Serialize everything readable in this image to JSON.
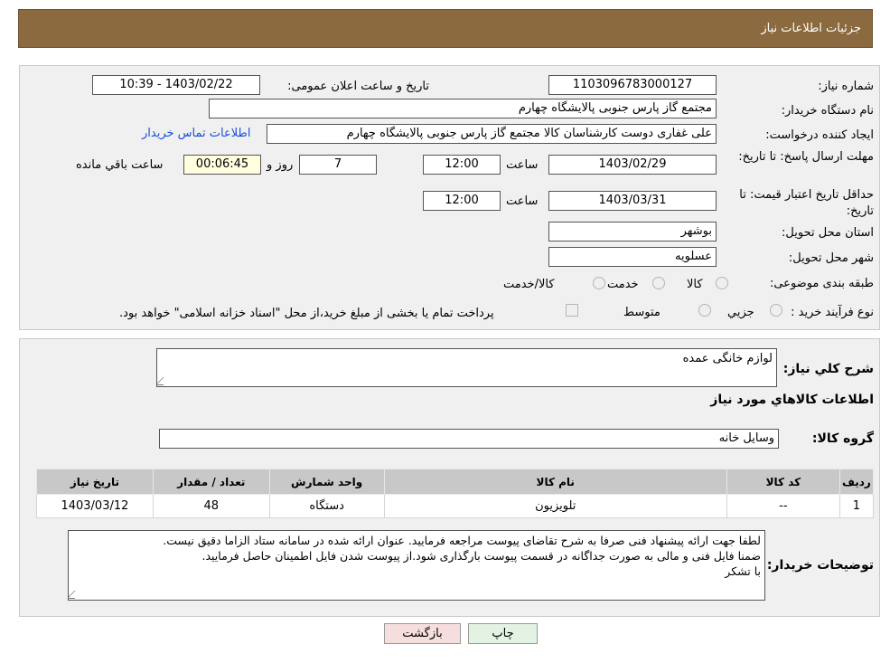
{
  "header": {
    "title": "جزئیات اطلاعات نیاز"
  },
  "form": {
    "need_number": {
      "label": "شماره نیاز:",
      "value": "1103096783000127"
    },
    "announce": {
      "label": "تاریخ و ساعت اعلان عمومی:",
      "value": "1403/02/22 - 10:39"
    },
    "buyer": {
      "label": "نام دستگاه خریدار:",
      "value": "مجتمع گاز پارس جنوبی  پالایشگاه چهارم"
    },
    "creator": {
      "label": "ایجاد کننده درخواست:",
      "value": "علی غفاری دوست کارشناسان کالا مجتمع گاز پارس جنوبی  پالایشگاه چهارم",
      "contact_link": "اطلاعات تماس خریدار"
    },
    "deadline": {
      "label": "مهلت ارسال پاسخ: تا تاریخ:",
      "date": "1403/02/29",
      "time_label": "ساعت",
      "time": "12:00",
      "days": "7",
      "days_label": "روز و",
      "remaining": "00:06:45",
      "remaining_label": "ساعت باقي مانده"
    },
    "validity": {
      "label": "حداقل تاریخ اعتبار قیمت: تا تاریخ:",
      "date": "1403/03/31",
      "time_label": "ساعت",
      "time": "12:00"
    },
    "province": {
      "label": "استان محل تحویل:",
      "value": "بوشهر"
    },
    "city": {
      "label": "شهر محل تحویل:",
      "value": "عسلویه"
    },
    "category": {
      "label": "طبقه بندی موضوعی:",
      "options": [
        "کالا",
        "خدمت",
        "کالا/خدمت"
      ]
    },
    "process": {
      "label": "نوع فرآیند خرید :",
      "options": [
        "جزیي",
        "متوسط"
      ],
      "note": "پرداخت تمام یا بخشی از مبلغ خرید،از محل \"اسناد خزانه اسلامی\" خواهد بود."
    }
  },
  "description": {
    "label": "شرح کلي نياز:",
    "value": "لوازم خانگی عمده"
  },
  "goods_info": {
    "title": "اطلاعات کالاهاي مورد نياز"
  },
  "goods_group": {
    "label": "گروه کالا:",
    "value": "وسایل خانه"
  },
  "table": {
    "headers": [
      "رديف",
      "کد کالا",
      "نام کالا",
      "واحد شمارش",
      "تعداد / مقدار",
      "تاریخ نیاز"
    ],
    "rows": [
      [
        "1",
        "--",
        "تلویزیون",
        "دستگاه",
        "48",
        "1403/03/12"
      ]
    ]
  },
  "buyer_notes": {
    "label": "توضیحات خریدار:",
    "lines": [
      "لطفا جهت ارائه پیشنهاد فنی صرفا به شرح تقاضای پیوست مراجعه فرمایید. عنوان ارائه شده در سامانه ستاد الزاما دقیق نیست.",
      "ضمنا فایل فنی و مالی به صورت جداگانه در قسمت پیوست بارگذاری شود.از پیوست شدن فایل اطمینان حاصل فرمایید.",
      "با تشکر"
    ]
  },
  "buttons": {
    "print": "چاپ",
    "back": "بازگشت"
  },
  "colors": {
    "header": "#8a6a3e",
    "link": "#1a4fd8",
    "back_button": "#f7dede",
    "print_button": "#e3f3e3"
  }
}
